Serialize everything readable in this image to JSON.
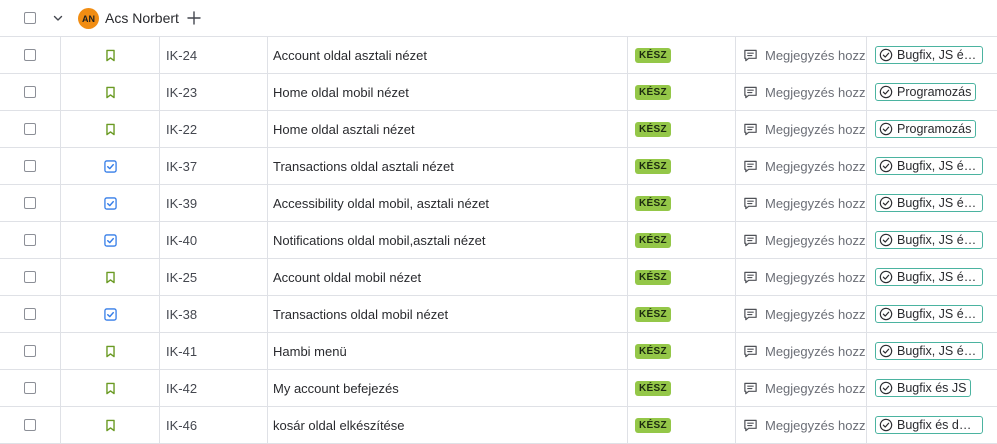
{
  "group": {
    "avatar_initials": "AN",
    "name": "Acs Norbert"
  },
  "colors": {
    "status_done": "#94c748",
    "label_border": "#4bb3a0",
    "story_icon": "#6a9a23",
    "task_icon": "#357de8",
    "avatar": "#f18d13"
  },
  "rows": [
    {
      "type": "story-icon",
      "key": "IK-24",
      "title": "Account oldal asztali nézet",
      "status": "KÉSZ",
      "comment": "Megjegyzés hozzáadása",
      "label": "Bugfix, JS és React"
    },
    {
      "type": "story-icon",
      "key": "IK-23",
      "title": "Home oldal mobil nézet",
      "status": "KÉSZ",
      "comment": "Megjegyzés hozzáadása",
      "label": "Programozás"
    },
    {
      "type": "story-icon",
      "key": "IK-22",
      "title": "Home oldal asztali nézet",
      "status": "KÉSZ",
      "comment": "Megjegyzés hozzáadása",
      "label": "Programozás"
    },
    {
      "type": "task-icon",
      "key": "IK-37",
      "title": "Transactions oldal asztali nézet",
      "status": "KÉSZ",
      "comment": "Megjegyzés hozzáadása",
      "label": "Bugfix, JS és React"
    },
    {
      "type": "task-icon",
      "key": "IK-39",
      "title": "Accessibility oldal mobil, asztali nézet",
      "status": "KÉSZ",
      "comment": "Megjegyzés hozzáadása",
      "label": "Bugfix, JS és React"
    },
    {
      "type": "task-icon",
      "key": "IK-40",
      "title": "Notifications oldal mobil,asztali nézet",
      "status": "KÉSZ",
      "comment": "Megjegyzés hozzáadása",
      "label": "Bugfix, JS és React"
    },
    {
      "type": "story-icon",
      "key": "IK-25",
      "title": "Account oldal mobil nézet",
      "status": "KÉSZ",
      "comment": "Megjegyzés hozzáadása",
      "label": "Bugfix, JS és React"
    },
    {
      "type": "task-icon",
      "key": "IK-38",
      "title": "Transactions oldal mobil nézet",
      "status": "KÉSZ",
      "comment": "Megjegyzés hozzáadása",
      "label": "Bugfix, JS és React"
    },
    {
      "type": "story-icon",
      "key": "IK-41",
      "title": "Hambi menü",
      "status": "KÉSZ",
      "comment": "Megjegyzés hozzáadása",
      "label": "Bugfix, JS és React"
    },
    {
      "type": "story-icon",
      "key": "IK-42",
      "title": "My account befejezés",
      "status": "KÉSZ",
      "comment": "Megjegyzés hozzáadása",
      "label": "Bugfix és JS"
    },
    {
      "type": "story-icon",
      "key": "IK-46",
      "title": "kosár oldal elkészítése",
      "status": "KÉSZ",
      "comment": "Megjegyzés hozzáadása",
      "label": "Bugfix és design"
    }
  ]
}
